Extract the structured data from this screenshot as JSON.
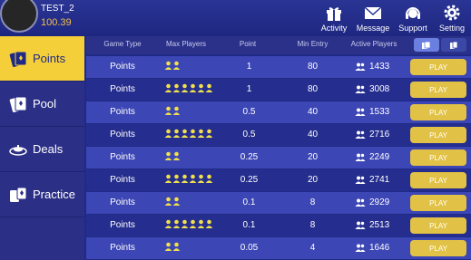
{
  "user": {
    "name": "TEST_2",
    "balance": "100.39"
  },
  "topnav": [
    {
      "label": "Activity",
      "icon": "gift-icon"
    },
    {
      "label": "Message",
      "icon": "envelope-icon"
    },
    {
      "label": "Support",
      "icon": "headset-icon"
    },
    {
      "label": "Setting",
      "icon": "gear-icon"
    }
  ],
  "sidebar": [
    {
      "label": "Points",
      "icon": "cards-icon",
      "active": true
    },
    {
      "label": "Pool",
      "icon": "cards-icon",
      "active": false
    },
    {
      "label": "Deals",
      "icon": "deals-icon",
      "active": false
    },
    {
      "label": "Practice",
      "icon": "practice-icon",
      "active": false
    }
  ],
  "table": {
    "headers": {
      "game_type": "Game Type",
      "max_players": "Max Players",
      "point": "Point",
      "min_entry": "Min Entry",
      "active_players": "Active Players"
    },
    "rows": [
      {
        "type": "Points",
        "players": 2,
        "point": "1",
        "entry": "80",
        "active": "1433",
        "action": "PLAY"
      },
      {
        "type": "Points",
        "players": 6,
        "point": "1",
        "entry": "80",
        "active": "3008",
        "action": "PLAY"
      },
      {
        "type": "Points",
        "players": 2,
        "point": "0.5",
        "entry": "40",
        "active": "1533",
        "action": "PLAY"
      },
      {
        "type": "Points",
        "players": 6,
        "point": "0.5",
        "entry": "40",
        "active": "2716",
        "action": "PLAY"
      },
      {
        "type": "Points",
        "players": 2,
        "point": "0.25",
        "entry": "20",
        "active": "2249",
        "action": "PLAY"
      },
      {
        "type": "Points",
        "players": 6,
        "point": "0.25",
        "entry": "20",
        "active": "2741",
        "action": "PLAY"
      },
      {
        "type": "Points",
        "players": 2,
        "point": "0.1",
        "entry": "8",
        "active": "2929",
        "action": "PLAY"
      },
      {
        "type": "Points",
        "players": 6,
        "point": "0.1",
        "entry": "8",
        "active": "2513",
        "action": "PLAY"
      },
      {
        "type": "Points",
        "players": 2,
        "point": "0.05",
        "entry": "4",
        "active": "1646",
        "action": "PLAY"
      }
    ]
  },
  "colors": {
    "accent": "#f5cf3a",
    "play": "#e2c246",
    "player_icon": "#f2e14a"
  }
}
